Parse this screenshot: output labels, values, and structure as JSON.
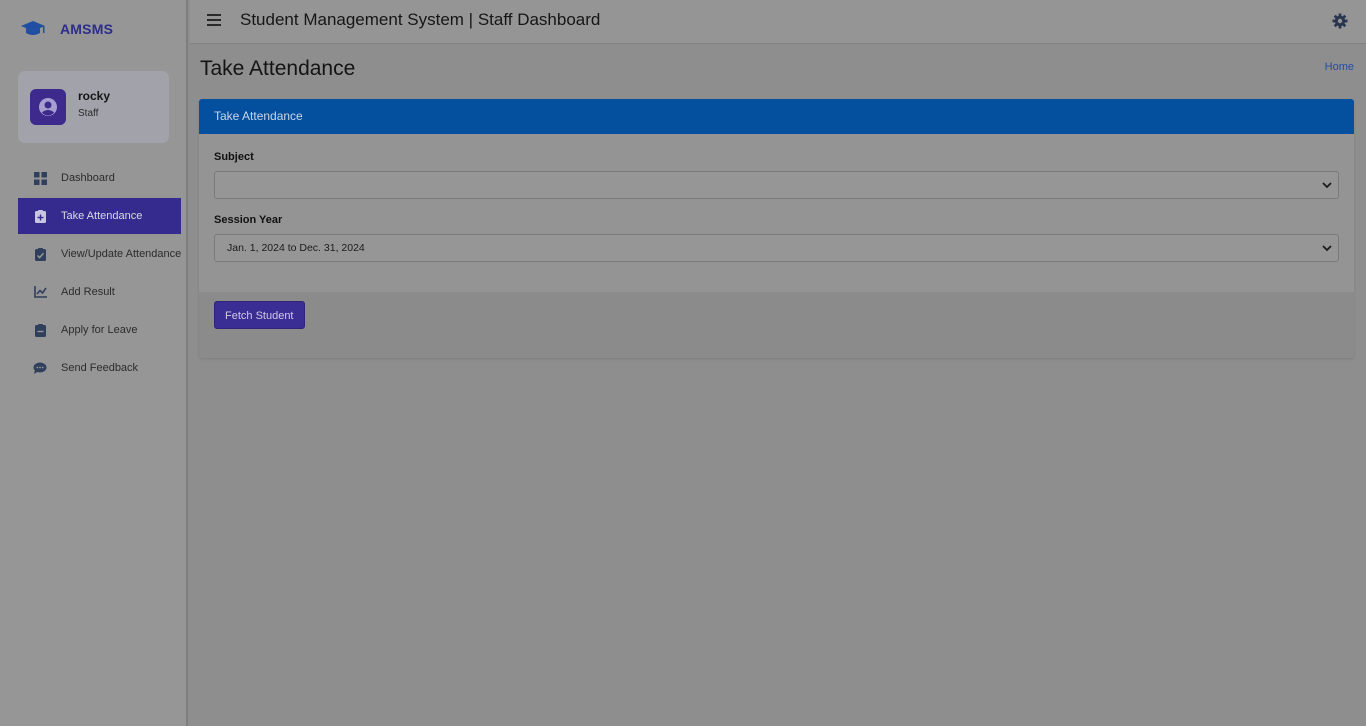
{
  "brand": {
    "name": "AMSMS",
    "icon": "graduation-cap-icon"
  },
  "user": {
    "name": "rocky",
    "role": "Staff",
    "icon": "user-circle-icon"
  },
  "sidebar": {
    "items": [
      {
        "label": "Dashboard",
        "icon": "dashboard-icon",
        "active": false
      },
      {
        "label": "Take Attendance",
        "icon": "clipboard-plus-icon",
        "active": true
      },
      {
        "label": "View/Update Attendance",
        "icon": "clipboard-check-icon",
        "active": false
      },
      {
        "label": "Add Result",
        "icon": "chart-line-icon",
        "active": false
      },
      {
        "label": "Apply for Leave",
        "icon": "clipboard-minus-icon",
        "active": false
      },
      {
        "label": "Send Feedback",
        "icon": "comments-icon",
        "active": false
      }
    ]
  },
  "header": {
    "title": "Student Management System | Staff Dashboard",
    "menu_icon": "hamburger-icon",
    "settings_icon": "gear-icon"
  },
  "page": {
    "title": "Take Attendance",
    "breadcrumb": "Home"
  },
  "card": {
    "header": "Take Attendance",
    "subject": {
      "label": "Subject",
      "value": ""
    },
    "session_year": {
      "label": "Session Year",
      "value": "Jan. 1, 2024 to Dec. 31, 2024"
    },
    "fetch_button": "Fetch Student"
  },
  "colors": {
    "accent": "#352b8e",
    "card_header": "#054f9f",
    "link": "#1f4ea3"
  }
}
